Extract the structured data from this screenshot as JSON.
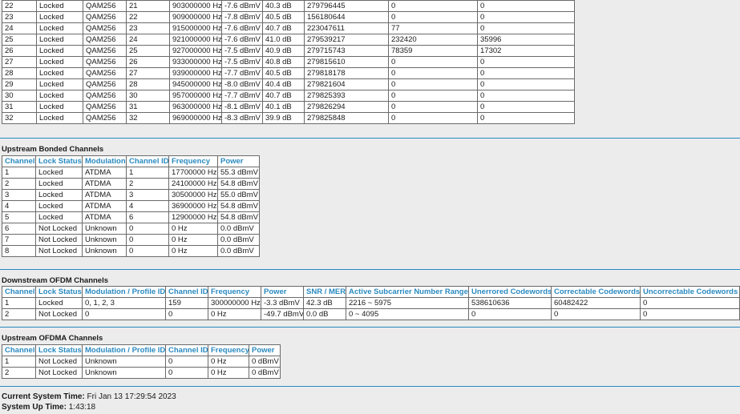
{
  "downstream_bonded": {
    "rows": [
      [
        "22",
        "Locked",
        "QAM256",
        "21",
        "903000000 Hz",
        "-7.6 dBmV",
        "40.3 dB",
        "279796445",
        "0",
        "0"
      ],
      [
        "23",
        "Locked",
        "QAM256",
        "22",
        "909000000 Hz",
        "-7.8 dBmV",
        "40.5 dB",
        "156180644",
        "0",
        "0"
      ],
      [
        "24",
        "Locked",
        "QAM256",
        "23",
        "915000000 Hz",
        "-7.6 dBmV",
        "40.7 dB",
        "223047611",
        "77",
        "0"
      ],
      [
        "25",
        "Locked",
        "QAM256",
        "24",
        "921000000 Hz",
        "-7.6 dBmV",
        "41.0 dB",
        "279539217",
        "232420",
        "35996"
      ],
      [
        "26",
        "Locked",
        "QAM256",
        "25",
        "927000000 Hz",
        "-7.5 dBmV",
        "40.9 dB",
        "279715743",
        "78359",
        "17302"
      ],
      [
        "27",
        "Locked",
        "QAM256",
        "26",
        "933000000 Hz",
        "-7.5 dBmV",
        "40.8 dB",
        "279815610",
        "0",
        "0"
      ],
      [
        "28",
        "Locked",
        "QAM256",
        "27",
        "939000000 Hz",
        "-7.7 dBmV",
        "40.5 dB",
        "279818178",
        "0",
        "0"
      ],
      [
        "29",
        "Locked",
        "QAM256",
        "28",
        "945000000 Hz",
        "-8.0 dBmV",
        "40.4 dB",
        "279821604",
        "0",
        "0"
      ],
      [
        "30",
        "Locked",
        "QAM256",
        "30",
        "957000000 Hz",
        "-7.7 dBmV",
        "40.7 dB",
        "279825393",
        "0",
        "0"
      ],
      [
        "31",
        "Locked",
        "QAM256",
        "31",
        "963000000 Hz",
        "-8.1 dBmV",
        "40.1 dB",
        "279826294",
        "0",
        "0"
      ],
      [
        "32",
        "Locked",
        "QAM256",
        "32",
        "969000000 Hz",
        "-8.3 dBmV",
        "39.9 dB",
        "279825848",
        "0",
        "0"
      ]
    ]
  },
  "upstream_bonded": {
    "title": "Upstream Bonded Channels",
    "headers": [
      "Channel",
      "Lock Status",
      "Modulation",
      "Channel ID",
      "Frequency",
      "Power"
    ],
    "rows": [
      [
        "1",
        "Locked",
        "ATDMA",
        "1",
        "17700000 Hz",
        "55.3 dBmV"
      ],
      [
        "2",
        "Locked",
        "ATDMA",
        "2",
        "24100000 Hz",
        "54.8 dBmV"
      ],
      [
        "3",
        "Locked",
        "ATDMA",
        "3",
        "30500000 Hz",
        "55.0 dBmV"
      ],
      [
        "4",
        "Locked",
        "ATDMA",
        "4",
        "36900000 Hz",
        "54.8 dBmV"
      ],
      [
        "5",
        "Locked",
        "ATDMA",
        "6",
        "12900000 Hz",
        "54.8 dBmV"
      ],
      [
        "6",
        "Not Locked",
        "Unknown",
        "0",
        "0 Hz",
        "0.0 dBmV"
      ],
      [
        "7",
        "Not Locked",
        "Unknown",
        "0",
        "0 Hz",
        "0.0 dBmV"
      ],
      [
        "8",
        "Not Locked",
        "Unknown",
        "0",
        "0 Hz",
        "0.0 dBmV"
      ]
    ]
  },
  "downstream_ofdm": {
    "title": "Downstream OFDM Channels",
    "headers": [
      "Channel",
      "Lock Status",
      "Modulation / Profile ID",
      "Channel ID",
      "Frequency",
      "Power",
      "SNR / MER",
      "Active Subcarrier Number Range",
      "Unerrored Codewords",
      "Correctable Codewords",
      "Uncorrectable Codewords"
    ],
    "rows": [
      [
        "1",
        "Locked",
        "0, 1, 2, 3",
        "159",
        "300000000 Hz",
        "-3.3 dBmV",
        "42.3 dB",
        "2216 ~ 5975",
        "538610636",
        "60482422",
        "0"
      ],
      [
        "2",
        "Not Locked",
        "0",
        "0",
        "0 Hz",
        "-49.7 dBmV",
        "0.0 dB",
        "0 ~ 4095",
        "0",
        "0",
        "0"
      ]
    ]
  },
  "upstream_ofdma": {
    "title": "Upstream OFDMA Channels",
    "headers": [
      "Channel",
      "Lock Status",
      "Modulation / Profile ID",
      "Channel ID",
      "Frequency",
      "Power"
    ],
    "rows": [
      [
        "1",
        "Not Locked",
        "Unknown",
        "0",
        "0 Hz",
        "0 dBmV"
      ],
      [
        "2",
        "Not Locked",
        "Unknown",
        "0",
        "0 Hz",
        "0 dBmV"
      ]
    ]
  },
  "system": {
    "time_label": "Current System Time:",
    "time_value": "Fri Jan 13 17:29:54 2023",
    "uptime_label": "System Up Time:",
    "uptime_value": "1:43:18"
  },
  "colors": {
    "header_text": "#2a8ac0",
    "rule": "#2a8ac0",
    "background": "#ececec"
  }
}
